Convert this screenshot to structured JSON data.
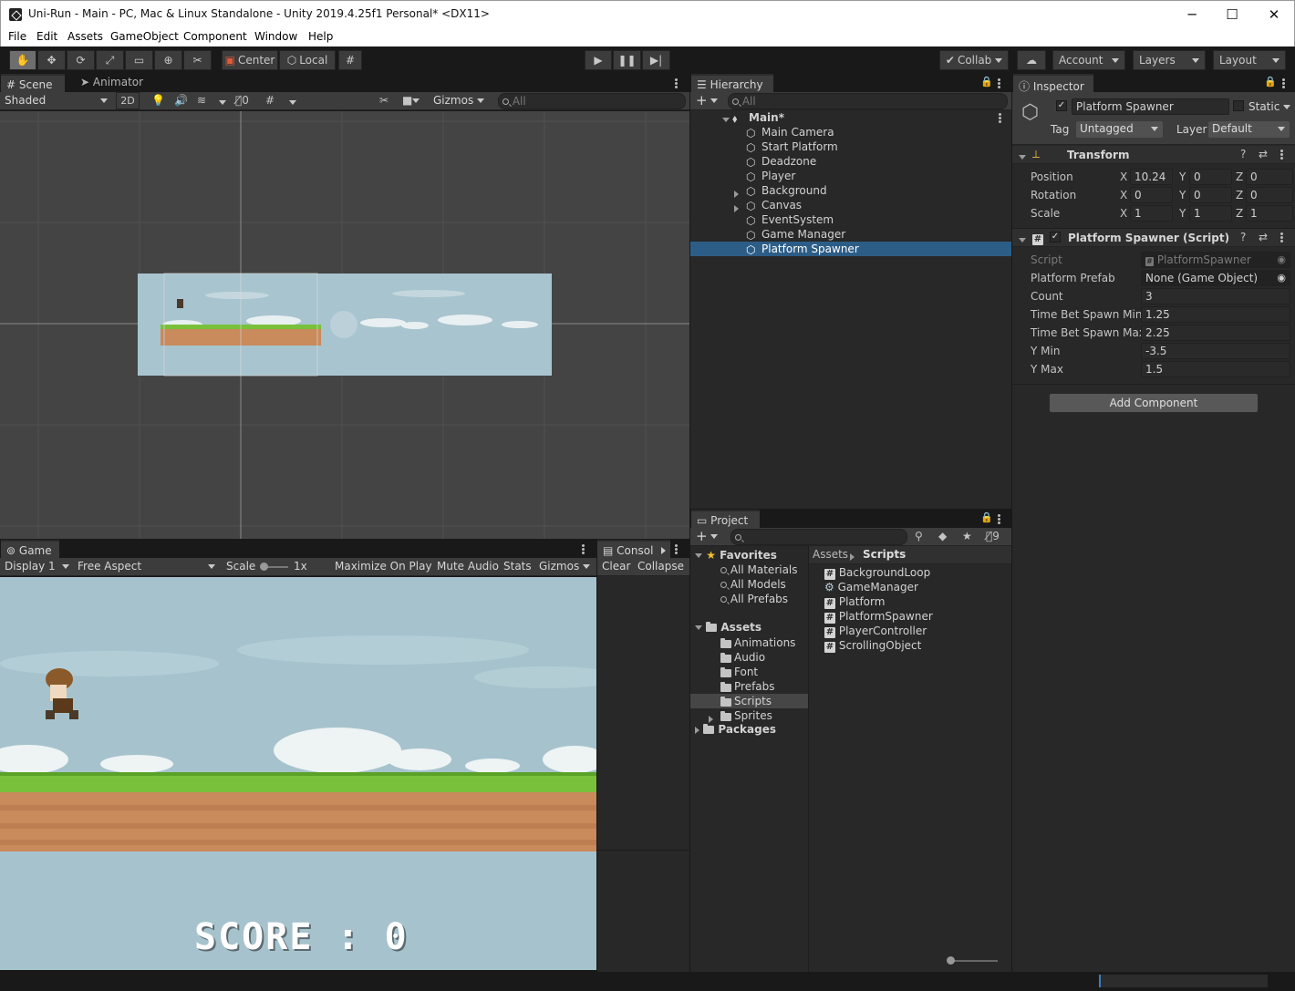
{
  "window": {
    "title": "Uni-Run - Main - PC, Mac & Linux Standalone - Unity 2019.4.25f1 Personal* <DX11>",
    "minimize": "─",
    "maximize": "☐",
    "close": "✕"
  },
  "menu": [
    "File",
    "Edit",
    "Assets",
    "GameObject",
    "Component",
    "Window",
    "Help"
  ],
  "toolbar": {
    "center": "Center",
    "local": "Local",
    "collab": "Collab",
    "account": "Account",
    "layers": "Layers",
    "layout": "Layout"
  },
  "scene": {
    "tab_scene": "Scene",
    "tab_animator": "Animator",
    "shading": "Shaded",
    "mode_2d": "2D",
    "hidden_count": "0",
    "gizmos": "Gizmos",
    "search_placeholder": "All"
  },
  "game": {
    "tab": "Game",
    "display": "Display 1",
    "aspect": "Free Aspect",
    "scale_label": "Scale",
    "scale_value": "1x",
    "maximize": "Maximize On Play",
    "mute": "Mute Audio",
    "stats": "Stats",
    "gizmos": "Gizmos",
    "score": "SCORE : 0"
  },
  "console": {
    "tab": "Consol",
    "clear": "Clear",
    "collapse": "Collapse"
  },
  "hierarchy": {
    "tab": "Hierarchy",
    "search_placeholder": "All",
    "scene": "Main*",
    "items": [
      {
        "label": "Main Camera",
        "expandable": false
      },
      {
        "label": "Start Platform",
        "expandable": false
      },
      {
        "label": "Deadzone",
        "expandable": false
      },
      {
        "label": "Player",
        "expandable": false
      },
      {
        "label": "Background",
        "expandable": true
      },
      {
        "label": "Canvas",
        "expandable": true
      },
      {
        "label": "EventSystem",
        "expandable": false
      },
      {
        "label": "Game Manager",
        "expandable": false
      },
      {
        "label": "Platform Spawner",
        "expandable": false,
        "selected": true
      }
    ]
  },
  "project": {
    "tab": "Project",
    "hidden_count": "9",
    "favorites": "Favorites",
    "favorite_items": [
      "All Materials",
      "All Models",
      "All Prefabs"
    ],
    "assets": "Assets",
    "asset_folders": [
      "Animations",
      "Audio",
      "Font",
      "Prefabs",
      "Scripts",
      "Sprites"
    ],
    "packages": "Packages",
    "breadcrumb": [
      "Assets",
      "Scripts"
    ],
    "files": [
      {
        "name": "BackgroundLoop",
        "icon": "script-icon"
      },
      {
        "name": "GameManager",
        "icon": "gear-icon"
      },
      {
        "name": "Platform",
        "icon": "script-icon"
      },
      {
        "name": "PlatformSpawner",
        "icon": "script-icon"
      },
      {
        "name": "PlayerController",
        "icon": "script-icon"
      },
      {
        "name": "ScrollingObject",
        "icon": "script-icon"
      }
    ]
  },
  "inspector": {
    "tab": "Inspector",
    "object_name": "Platform Spawner",
    "static": "Static",
    "tag_label": "Tag",
    "tag_value": "Untagged",
    "layer_label": "Layer",
    "layer_value": "Default",
    "transform": {
      "title": "Transform",
      "rows": [
        {
          "label": "Position",
          "x": "10.24",
          "y": "0",
          "z": "0"
        },
        {
          "label": "Rotation",
          "x": "0",
          "y": "0",
          "z": "0"
        },
        {
          "label": "Scale",
          "x": "1",
          "y": "1",
          "z": "1"
        }
      ]
    },
    "script_component": {
      "title": "Platform Spawner (Script)",
      "rows": [
        {
          "label": "Script",
          "value": "PlatformSpawner"
        },
        {
          "label": "Platform Prefab",
          "value": "None (Game Object)"
        },
        {
          "label": "Count",
          "value": "3"
        },
        {
          "label": "Time Bet Spawn Min",
          "value": "1.25"
        },
        {
          "label": "Time Bet Spawn Max",
          "value": "2.25"
        },
        {
          "label": "Y Min",
          "value": "-3.5"
        },
        {
          "label": "Y Max",
          "value": "1.5"
        }
      ]
    },
    "add_component": "Add Component"
  },
  "axes": {
    "x": "X",
    "y": "Y",
    "z": "Z"
  },
  "colors": {
    "selection": "#2c5d87",
    "panel": "#282828",
    "toolbar": "#3c3c3c",
    "sky": "#a6c3cd",
    "grass": "#79c13a",
    "dirt": "#c98a5c"
  }
}
